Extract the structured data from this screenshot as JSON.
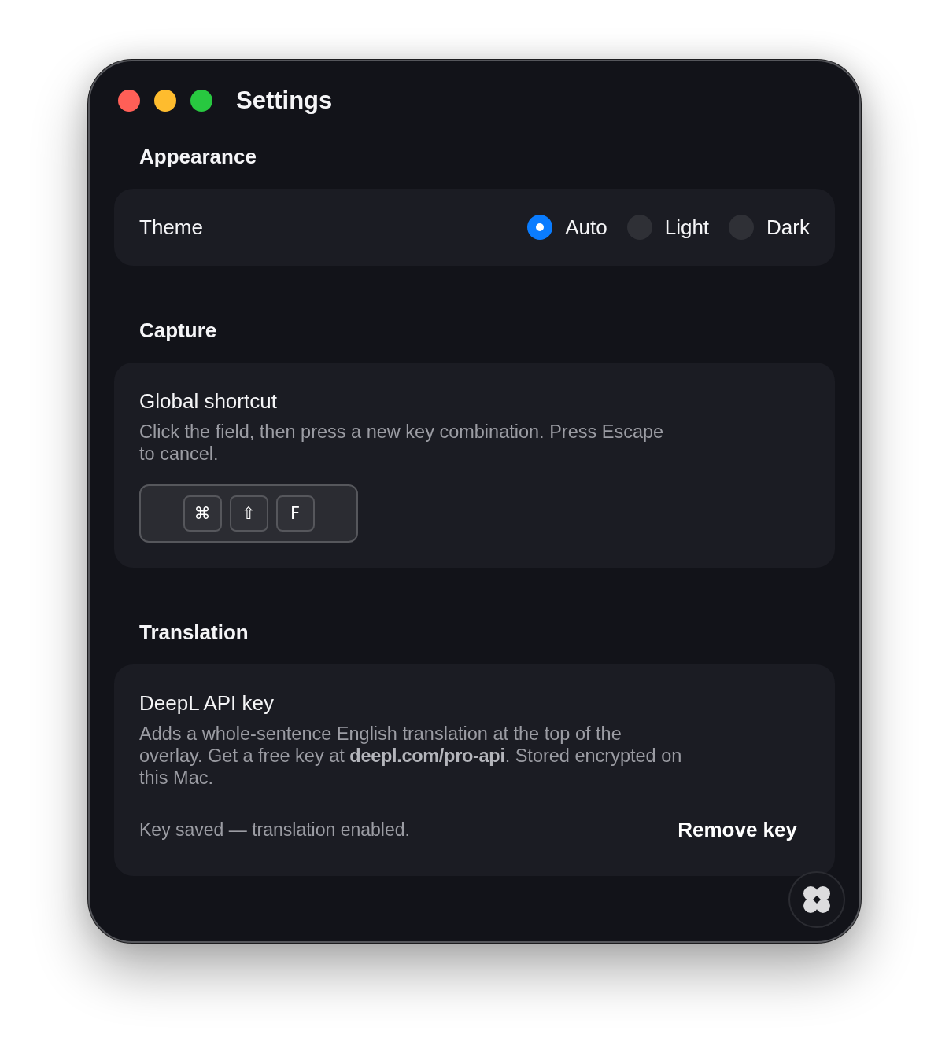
{
  "window": {
    "title": "Settings"
  },
  "sections": [
    {
      "heading": "Appearance",
      "kind": "radio",
      "label": "Theme",
      "options": [
        {
          "label": "Auto",
          "selected": true
        },
        {
          "label": "Light",
          "selected": false
        },
        {
          "label": "Dark",
          "selected": false
        }
      ]
    },
    {
      "heading": "Capture",
      "kind": "shortcut",
      "title": "Global shortcut",
      "description": "Click the field, then press a new key combination. Press Escape to cancel.",
      "keys": [
        "⌘",
        "⇧",
        "F"
      ]
    },
    {
      "heading": "Translation",
      "kind": "api_key",
      "title": "DeepL API key",
      "description": "Adds a whole-sentence English translation at the top of the overlay. Get a free key at **deepl.com/pro-api**. Stored encrypted on this Mac.",
      "status": "Key saved — translation enabled.",
      "button": "Remove key"
    }
  ]
}
